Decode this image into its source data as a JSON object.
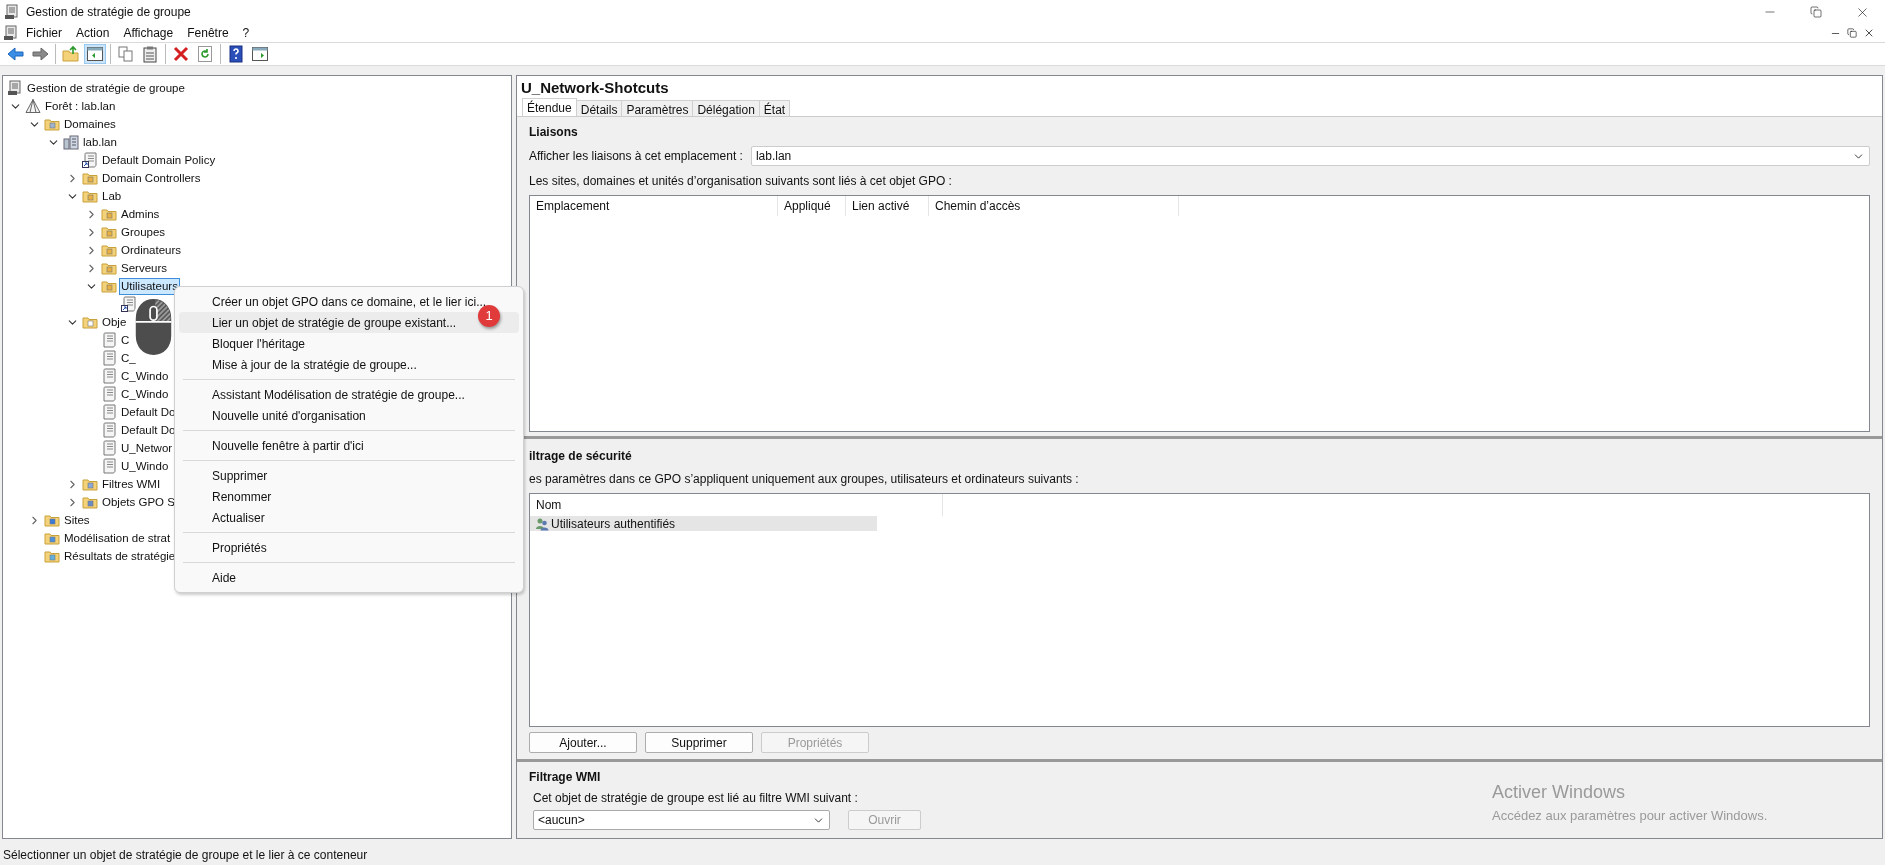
{
  "window": {
    "title": "Gestion de stratégie de groupe"
  },
  "menu": [
    "Fichier",
    "Action",
    "Affichage",
    "Fenêtre",
    "?"
  ],
  "toolbar": [
    [
      {
        "kind": "back",
        "pressed": false
      },
      {
        "kind": "forward",
        "pressed": false
      }
    ],
    [
      {
        "kind": "up",
        "pressed": false
      },
      {
        "kind": "tree",
        "pressed": true
      }
    ],
    [
      {
        "kind": "copy",
        "pressed": false
      },
      {
        "kind": "paste",
        "pressed": false
      }
    ],
    [
      {
        "kind": "delete",
        "pressed": false
      },
      {
        "kind": "refresh",
        "pressed": false
      }
    ],
    [
      {
        "kind": "help",
        "pressed": false
      },
      {
        "kind": "pane",
        "pressed": false
      }
    ]
  ],
  "tree": {
    "label": "Gestion de stratégie de groupe",
    "kind": "console",
    "selected": false,
    "children": [
      {
        "label": "Forêt : lab.lan",
        "kind": "forest",
        "expanded": true,
        "selected": false,
        "children": [
          {
            "label": "Domaines",
            "kind": "domains",
            "expanded": true,
            "selected": false,
            "children": [
              {
                "label": "lab.lan",
                "kind": "domain",
                "expanded": true,
                "selected": false,
                "children": [
                  {
                    "label": "Default Domain Policy",
                    "kind": "gpo-link",
                    "selected": false
                  },
                  {
                    "label": "Domain Controllers",
                    "kind": "ou",
                    "expanded": false,
                    "selected": false
                  },
                  {
                    "label": "Lab",
                    "kind": "ou",
                    "expanded": true,
                    "selected": false,
                    "children": [
                      {
                        "label": "Admins",
                        "kind": "ou",
                        "expanded": false,
                        "selected": false
                      },
                      {
                        "label": "Groupes",
                        "kind": "ou",
                        "expanded": false,
                        "selected": false
                      },
                      {
                        "label": "Ordinateurs",
                        "kind": "ou",
                        "expanded": false,
                        "selected": false
                      },
                      {
                        "label": "Serveurs",
                        "kind": "ou",
                        "expanded": false,
                        "selected": false
                      },
                      {
                        "label": "Utilisateurs",
                        "kind": "ou",
                        "expanded": true,
                        "selected": true,
                        "children": [
                          {
                            "kind": "gpo-link",
                            "selected": false
                          }
                        ]
                      }
                    ]
                  },
                  {
                    "label": "Obje",
                    "kind": "gpo-folder",
                    "expanded": true,
                    "selected": false,
                    "children": [
                      {
                        "label": "C",
                        "kind": "gpo",
                        "selected": false
                      },
                      {
                        "label": "C_",
                        "kind": "gpo",
                        "selected": false
                      },
                      {
                        "label": "C_Windo",
                        "kind": "gpo",
                        "selected": false
                      },
                      {
                        "label": "C_Windo",
                        "kind": "gpo",
                        "selected": false
                      },
                      {
                        "label": "Default Do",
                        "kind": "gpo",
                        "selected": false
                      },
                      {
                        "label": "Default Do",
                        "kind": "gpo",
                        "selected": false
                      },
                      {
                        "label": "U_Networ",
                        "kind": "gpo",
                        "selected": false
                      },
                      {
                        "label": "U_Windo",
                        "kind": "gpo",
                        "selected": false
                      }
                    ]
                  },
                  {
                    "label": "Filtres WMI",
                    "kind": "wmi",
                    "expanded": false,
                    "selected": false
                  },
                  {
                    "label": "Objets GPO S",
                    "kind": "starter",
                    "expanded": false,
                    "selected": false
                  }
                ]
              }
            ]
          },
          {
            "label": "Sites",
            "kind": "sites",
            "expanded": false,
            "selected": false
          },
          {
            "label": "Modélisation de strat",
            "kind": "modeling",
            "selected": false
          },
          {
            "label": "Résultats de stratégie",
            "kind": "results",
            "selected": false
          }
        ]
      }
    ]
  },
  "context_menu": [
    {
      "kind": "item",
      "label": "Créer un objet GPO dans ce domaine, et le lier ici...",
      "highlighted": false
    },
    {
      "kind": "item",
      "label": "Lier un objet de stratégie de groupe existant...",
      "highlighted": true
    },
    {
      "kind": "item",
      "label": "Bloquer l'héritage",
      "highlighted": false
    },
    {
      "kind": "item",
      "label": "Mise à jour de la stratégie de groupe...",
      "highlighted": false
    },
    {
      "kind": "separator"
    },
    {
      "kind": "item",
      "label": "Assistant Modélisation de stratégie de groupe...",
      "highlighted": false
    },
    {
      "kind": "item",
      "label": "Nouvelle unité d'organisation",
      "highlighted": false
    },
    {
      "kind": "separator"
    },
    {
      "kind": "item",
      "label": "Nouvelle fenêtre à partir d'ici",
      "highlighted": false
    },
    {
      "kind": "separator"
    },
    {
      "kind": "item",
      "label": "Supprimer",
      "highlighted": false
    },
    {
      "kind": "item",
      "label": "Renommer",
      "highlighted": false
    },
    {
      "kind": "item",
      "label": "Actualiser",
      "highlighted": false
    },
    {
      "kind": "separator"
    },
    {
      "kind": "item",
      "label": "Propriétés",
      "highlighted": false
    },
    {
      "kind": "separator"
    },
    {
      "kind": "item",
      "label": "Aide",
      "highlighted": false
    }
  ],
  "step_badge": "1",
  "details": {
    "title": "U_Network-Shotcuts",
    "tabs": [
      {
        "label": "Étendue",
        "selected": true
      },
      {
        "label": "Détails",
        "selected": false
      },
      {
        "label": "Paramètres",
        "selected": false
      },
      {
        "label": "Délégation",
        "selected": false
      },
      {
        "label": "État",
        "selected": false
      }
    ],
    "links": {
      "heading": "Liaisons",
      "location_label": "Afficher les liaisons à cet emplacement :",
      "location_value": "lab.lan",
      "description": "Les sites, domaines et unités d’organisation suivants sont liés à cet objet GPO :",
      "columns": [
        "Emplacement",
        "Appliqué",
        "Lien activé",
        "Chemin d’accès"
      ]
    },
    "security": {
      "heading": "iltrage de sécurité",
      "description": "es paramètres dans ce GPO s’appliquent uniquement aux groupes, utilisateurs et ordinateurs suivants :",
      "columns": [
        "Nom"
      ],
      "rows": [
        {
          "name": "Utilisateurs authentifiés",
          "selected": true
        }
      ],
      "buttons": [
        {
          "label": "Ajouter...",
          "disabled": false
        },
        {
          "label": "Supprimer",
          "disabled": false
        },
        {
          "label": "Propriétés",
          "disabled": true
        }
      ]
    },
    "wmi": {
      "heading": "Filtrage WMI",
      "description": "Cet objet de stratégie de groupe est lié au filtre WMI suivant :",
      "value": "<aucun>",
      "button": {
        "label": "Ouvrir",
        "disabled": true
      }
    }
  },
  "activation": {
    "title": "Activer Windows",
    "subtitle": "Accédez aux paramètres pour activer Windows."
  },
  "status_bar": "Sélectionner un objet de stratégie de groupe et le lier à ce conteneur"
}
